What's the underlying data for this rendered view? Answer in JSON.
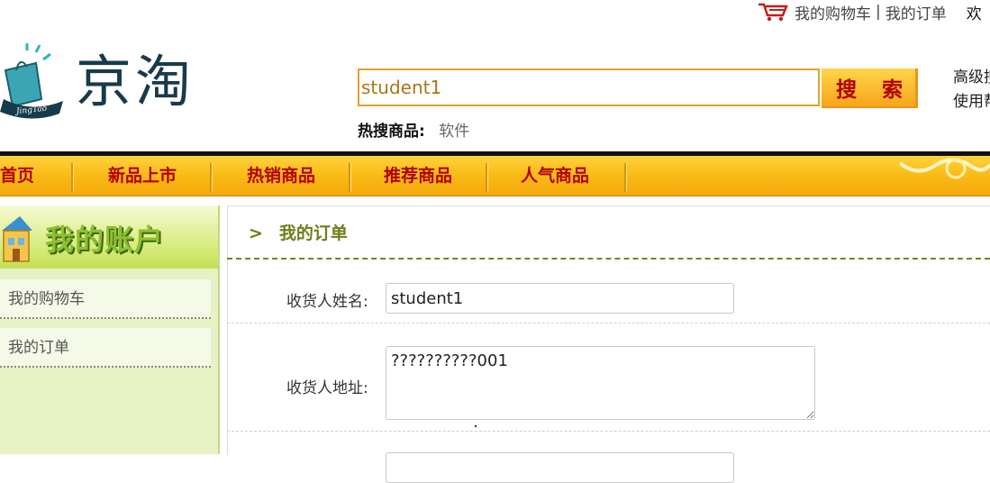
{
  "topbar": {
    "cart": "我的购物车",
    "separator": "|",
    "orders": "我的订单",
    "welcome": "欢"
  },
  "logo": {
    "text": "京淘",
    "badge": "JingTao"
  },
  "search": {
    "value": "student1",
    "button": "搜 索"
  },
  "hot": {
    "label": "热搜商品:",
    "item": "软件"
  },
  "side_links": {
    "advanced": "高级搜",
    "help": "使用帮"
  },
  "nav": {
    "items": [
      "首页",
      "新品上市",
      "热销商品",
      "推荐商品",
      "人气商品"
    ]
  },
  "sidebar": {
    "title": "我的账户",
    "items": [
      "我的购物车",
      "我的订单"
    ]
  },
  "breadcrumb": {
    "arrow": ">",
    "title": "我的订单"
  },
  "form": {
    "name_label": "收货人姓名:",
    "name_value": "student1",
    "address_label": "收货人地址:",
    "address_value": "??????????001"
  },
  "colors": {
    "nav_bg": "#f9b814",
    "nav_text": "#b10000",
    "accent_green": "#6d7f1a",
    "search_border": "#e3a22a"
  }
}
